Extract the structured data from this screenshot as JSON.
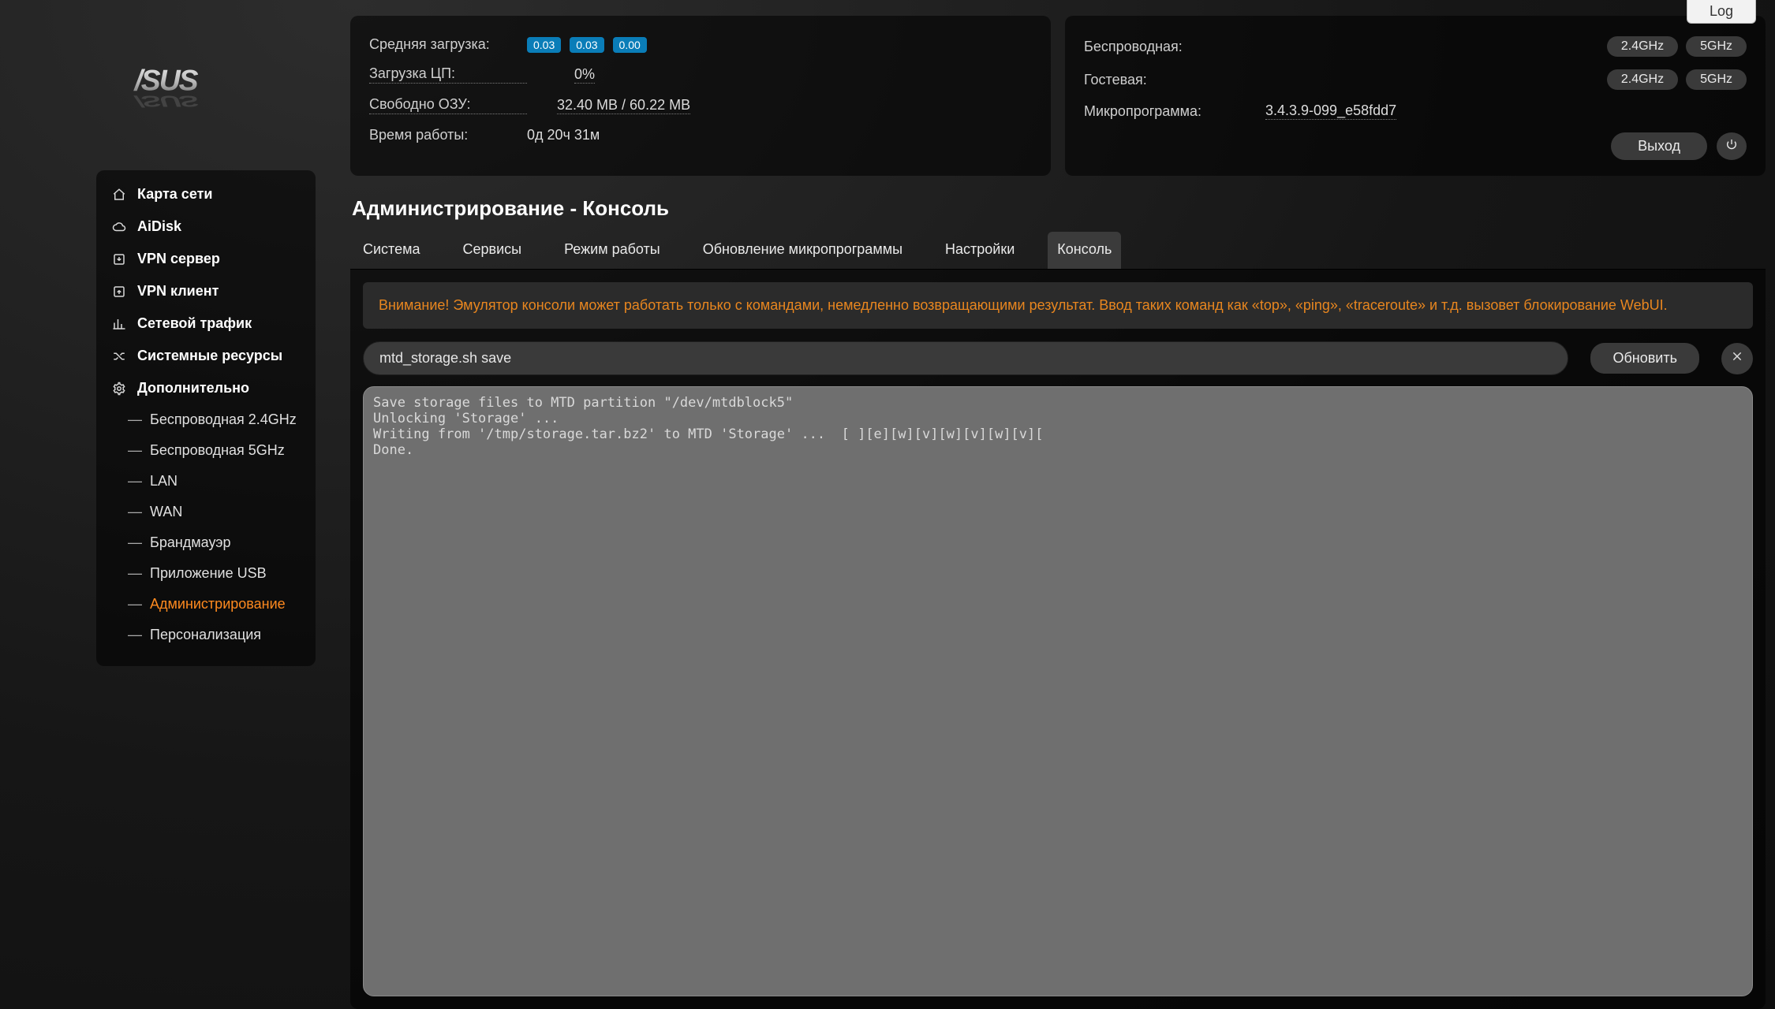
{
  "log_tab": "Log",
  "stats": {
    "avg_load_label": "Средняя загрузка:",
    "avg_load_values": [
      "0.03",
      "0.03",
      "0.00"
    ],
    "cpu_label": "Загрузка ЦП:",
    "cpu_value": "0%",
    "ram_label": "Свободно ОЗУ:",
    "ram_value": "32.40 MB / 60.22 MB",
    "uptime_label": "Время работы:",
    "uptime_value": "0д 20ч 31м"
  },
  "net": {
    "wireless_label": "Беспроводная:",
    "guest_label": "Гостевая:",
    "fw_label": "Микропрограмма:",
    "fw_value": "3.4.3.9-099_e58fdd7",
    "ghz1": "2.4GHz",
    "ghz2": "5GHz",
    "logout": "Выход"
  },
  "sidebar": {
    "items": [
      {
        "label": "Карта сети"
      },
      {
        "label": "AiDisk"
      },
      {
        "label": "VPN сервер"
      },
      {
        "label": "VPN клиент"
      },
      {
        "label": "Сетевой трафик"
      },
      {
        "label": "Системные ресурсы"
      },
      {
        "label": "Дополнительно"
      }
    ],
    "subitems": [
      {
        "label": "Беспроводная 2.4GHz"
      },
      {
        "label": "Беспроводная 5GHz"
      },
      {
        "label": "LAN"
      },
      {
        "label": "WAN"
      },
      {
        "label": "Брандмауэр"
      },
      {
        "label": "Приложение USB"
      },
      {
        "label": "Администрирование",
        "active": true
      },
      {
        "label": "Персонализация"
      }
    ]
  },
  "page_title": "Администрирование - Консоль",
  "tabs": [
    {
      "label": "Система"
    },
    {
      "label": "Сервисы"
    },
    {
      "label": "Режим работы"
    },
    {
      "label": "Обновление микропрограммы"
    },
    {
      "label": "Настройки"
    },
    {
      "label": "Консоль",
      "active": true
    }
  ],
  "warning": "Внимание! Эмулятор консоли может работать только с командами, немедленно возвращающими результат. Ввод таких команд как «top», «ping», «traceroute» и т.д. вызовет блокирование WebUI.",
  "command_value": "mtd_storage.sh save",
  "refresh_label": "Обновить",
  "terminal_output": "Save storage files to MTD partition \"/dev/mtdblock5\"\nUnlocking 'Storage' ...\nWriting from '/tmp/storage.tar.bz2' to MTD 'Storage' ...  [ ][e][w][v][w][v][w][v][\nDone."
}
